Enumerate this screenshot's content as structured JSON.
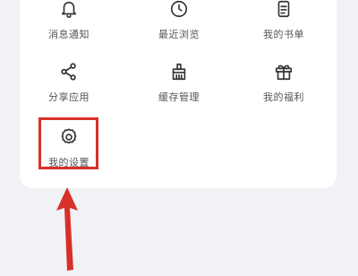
{
  "menu": {
    "row1": [
      {
        "label": "消息通知",
        "icon": "bell-icon"
      },
      {
        "label": "最近浏览",
        "icon": "clock-icon"
      },
      {
        "label": "我的书单",
        "icon": "document-list-icon"
      }
    ],
    "row2": [
      {
        "label": "分享应用",
        "icon": "share-icon"
      },
      {
        "label": "缓存管理",
        "icon": "broom-icon"
      },
      {
        "label": "我的福利",
        "icon": "gift-icon"
      }
    ],
    "row3": [
      {
        "label": "我的设置",
        "icon": "gear-icon"
      }
    ]
  },
  "annotation": {
    "highlight_color": "#d8302a",
    "arrow_color": "#d8302a"
  }
}
